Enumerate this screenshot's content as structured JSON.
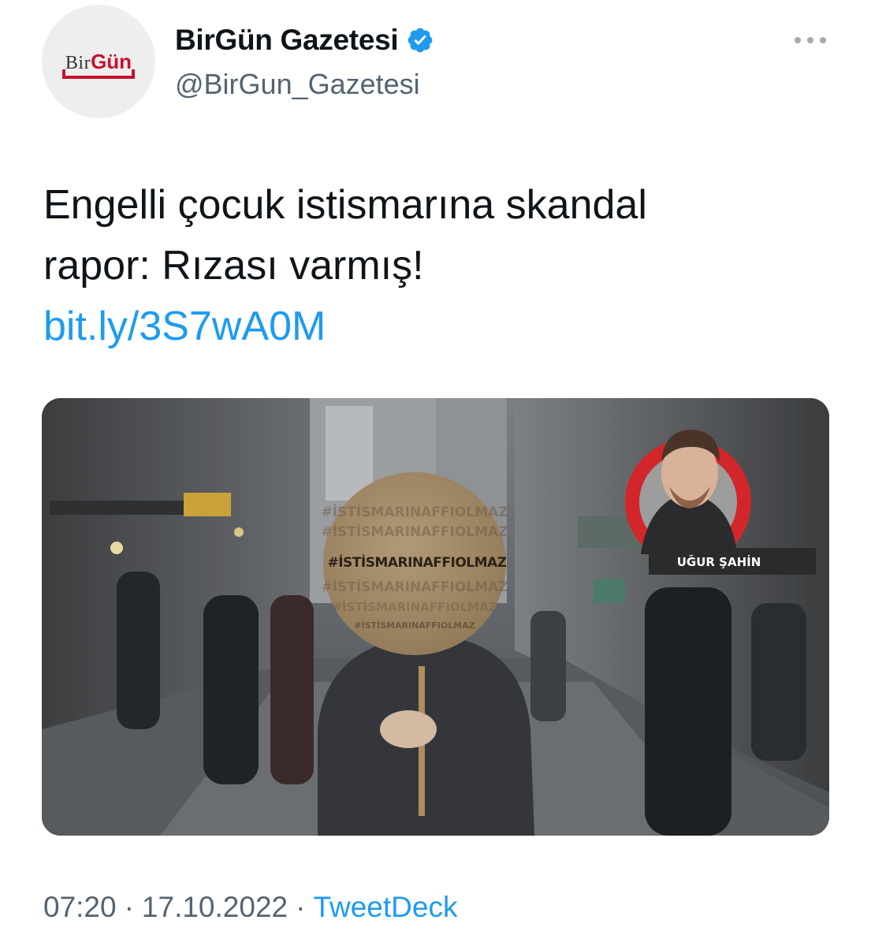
{
  "author": {
    "display_name": "BirGün Gazetesi",
    "handle": "@BirGun_Gazetesi",
    "verified": true,
    "avatar_logo": {
      "part1": "Bir",
      "part2": "Gün"
    },
    "verified_icon": "verified-badge-icon",
    "more_icon": "more-options-icon"
  },
  "tweet": {
    "text_line1": "Engelli çocuk istismarına skandal",
    "text_line2": "rapor: Rızası varmış!",
    "link": "bit.ly/3S7wA0M"
  },
  "media": {
    "sign_text": "#İSTİSMARINAFFIOLMAZ",
    "reporter_name": "UĞUR ŞAHİN"
  },
  "meta": {
    "time": "07:20",
    "date": "17.10.2022",
    "separator": "·",
    "source": "TweetDeck"
  },
  "colors": {
    "link": "#1d9bf0",
    "secondary_text": "#536471",
    "brand_red": "#c8102e",
    "verified_blue": "#1d9bf0"
  }
}
